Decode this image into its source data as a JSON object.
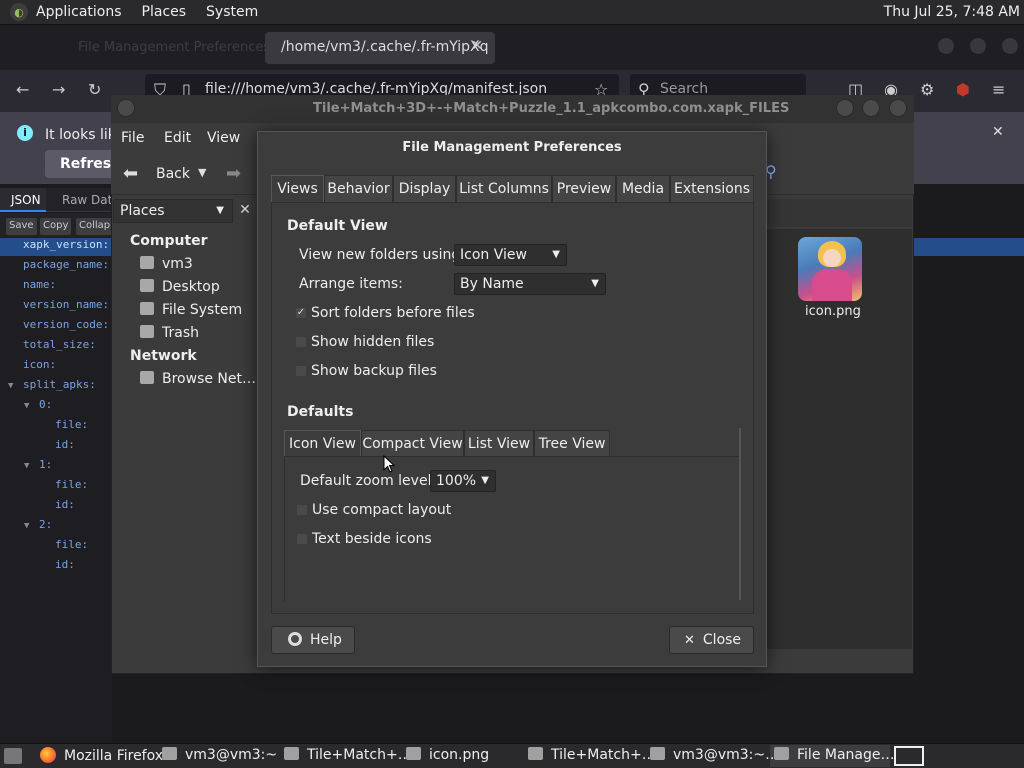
{
  "top_panel": {
    "menus": [
      "Applications",
      "Places",
      "System"
    ],
    "clock": "Thu Jul 25,  7:48 AM"
  },
  "firefox": {
    "active_tab": "/home/vm3/.cache/.fr-mYipXq",
    "faded_tab": "File Management Preferences",
    "url": "file:///home/vm3/.cache/.fr-mYipXq/manifest.json",
    "search_placeholder": "Search",
    "notice_text": "It looks like",
    "refresh_label": "Refresh"
  },
  "json_viewer": {
    "tabs": [
      "JSON",
      "Raw Data"
    ],
    "buttons": [
      "Save",
      "Copy",
      "Collap"
    ],
    "rows": [
      {
        "indent": 0,
        "twisty": "",
        "key": "xapk_version:",
        "selected": true
      },
      {
        "indent": 0,
        "twisty": "",
        "key": "package_name:"
      },
      {
        "indent": 0,
        "twisty": "",
        "key": "name:"
      },
      {
        "indent": 0,
        "twisty": "",
        "key": "version_name:"
      },
      {
        "indent": 0,
        "twisty": "",
        "key": "version_code:"
      },
      {
        "indent": 0,
        "twisty": "",
        "key": "total_size:"
      },
      {
        "indent": 0,
        "twisty": "",
        "key": "icon:"
      },
      {
        "indent": 0,
        "twisty": "▼",
        "key": "split_apks:"
      },
      {
        "indent": 1,
        "twisty": "▼",
        "key": "0:"
      },
      {
        "indent": 2,
        "twisty": "",
        "key": "file:"
      },
      {
        "indent": 2,
        "twisty": "",
        "key": "id:"
      },
      {
        "indent": 1,
        "twisty": "▼",
        "key": "1:"
      },
      {
        "indent": 2,
        "twisty": "",
        "key": "file:"
      },
      {
        "indent": 2,
        "twisty": "",
        "key": "id:"
      },
      {
        "indent": 1,
        "twisty": "▼",
        "key": "2:"
      },
      {
        "indent": 2,
        "twisty": "",
        "key": "file:"
      },
      {
        "indent": 2,
        "twisty": "",
        "key": "id:"
      }
    ]
  },
  "file_manager": {
    "title": "Tile+Match+3D+-+Match+Puzzle_1.1_apkcombo.com.xapk_FILES",
    "menus": [
      "File",
      "Edit",
      "View"
    ],
    "back_label": "Back",
    "places_label": "Places",
    "sidebar": {
      "computer_heading": "Computer",
      "computer_items": [
        "vm3",
        "Desktop",
        "File System",
        "Trash"
      ],
      "network_heading": "Network",
      "network_items": [
        "Browse Net…"
      ]
    },
    "file_label": "icon.png"
  },
  "preferences": {
    "title": "File Management Preferences",
    "tabs": [
      "Views",
      "Behavior",
      "Display",
      "List Columns",
      "Preview",
      "Media",
      "Extensions"
    ],
    "active_tab": "Views",
    "default_view_heading": "Default View",
    "view_new_label": "View new folders using:",
    "view_new_value": "Icon View",
    "arrange_label": "Arrange items:",
    "arrange_value": "By Name",
    "checks": [
      {
        "label": "Sort folders before files",
        "checked": true
      },
      {
        "label": "Show hidden files",
        "checked": false
      },
      {
        "label": "Show backup files",
        "checked": false
      }
    ],
    "defaults_heading": "Defaults",
    "sub_tabs": [
      "Icon View",
      "Compact View",
      "List View",
      "Tree View"
    ],
    "active_sub_tab": "Icon View",
    "zoom_label": "Default zoom level:",
    "zoom_value": "100%",
    "icon_checks": [
      {
        "label": "Use compact layout",
        "checked": false
      },
      {
        "label": "Text beside icons",
        "checked": false
      }
    ],
    "help_label": "Help",
    "close_label": "Close"
  },
  "taskbar": {
    "items": [
      "Mozilla Firefox",
      "vm3@vm3:~",
      "Tile+Match+…",
      "icon.png",
      "Tile+Match+…",
      "vm3@vm3:~…",
      "File Manage…"
    ]
  }
}
